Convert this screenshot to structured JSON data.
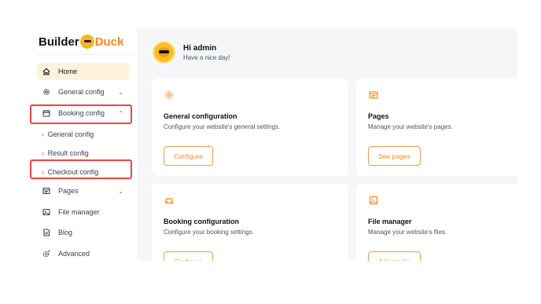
{
  "logo": {
    "prefix": "Builder",
    "suffix": "Duck"
  },
  "sidebar": {
    "collapse_glyph": "‹",
    "items": [
      {
        "label": "Home",
        "icon": "home-icon",
        "active": true
      },
      {
        "label": "General config",
        "icon": "gear-icon",
        "chevron": "⌄"
      },
      {
        "label": "Booking config",
        "icon": "calendar-icon",
        "chevron": "⌃"
      },
      {
        "label": "Pages",
        "icon": "pages-icon",
        "chevron": "⌄"
      },
      {
        "label": "File manager",
        "icon": "file-icon"
      },
      {
        "label": "Blog",
        "icon": "document-icon"
      },
      {
        "label": "Advanced",
        "icon": "advanced-gear-icon"
      }
    ],
    "sub_items": [
      {
        "label": "General config"
      },
      {
        "label": "Result config"
      },
      {
        "label": "Checkout config"
      }
    ]
  },
  "greeting": {
    "title": "Hi admin",
    "subtitle": "Have a nice day!"
  },
  "cards": [
    {
      "title": "General configuration",
      "description": "Configure your website's general settings.",
      "button": "Configure",
      "icon": "gear-icon"
    },
    {
      "title": "Pages",
      "description": "Manage your website's pages.",
      "button": "See pages",
      "icon": "pages-icon"
    },
    {
      "title": "Booking configuration",
      "description": "Configure your booking settings.",
      "button": "Configure",
      "icon": "car-icon"
    },
    {
      "title": "File manager",
      "description": "Manage your website's files.",
      "button": "Add media",
      "icon": "image-icon"
    }
  ],
  "colors": {
    "accent": "#f08a1c",
    "active_bg": "#fdf3dc",
    "highlight": "#ef4444",
    "main_bg": "#f5f6f8"
  }
}
